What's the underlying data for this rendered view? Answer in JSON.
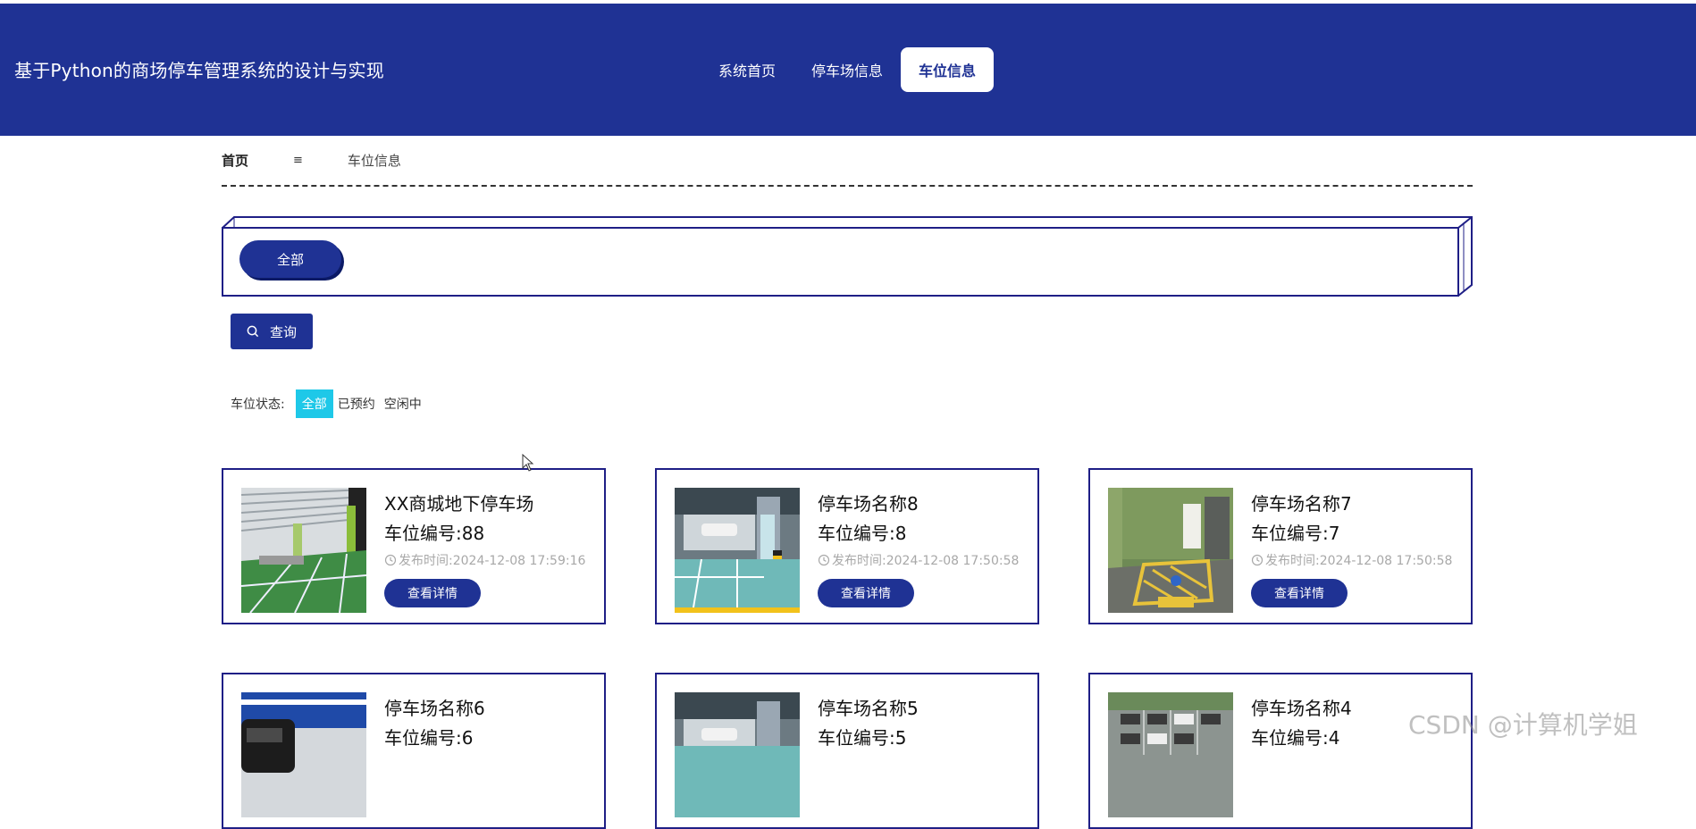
{
  "header": {
    "site_title": "基于Python的商场停车管理系统的设计与实现",
    "nav": [
      {
        "label": "系统首页",
        "active": false
      },
      {
        "label": "停车场信息",
        "active": false
      },
      {
        "label": "车位信息",
        "active": true
      }
    ]
  },
  "breadcrumb": {
    "home": "首页",
    "separator": "≡",
    "current": "车位信息"
  },
  "filter": {
    "category_all": "全部"
  },
  "query_button": "查询",
  "status": {
    "label": "车位状态:",
    "options": [
      {
        "label": "全部",
        "active": true
      },
      {
        "label": "已预约",
        "active": false
      },
      {
        "label": "空闲中",
        "active": false
      }
    ]
  },
  "cards": [
    {
      "name": "XX商城地下停车场",
      "number": "车位编号:88",
      "time": "发布时间:2024-12-08 17:59:16",
      "button": "查看详情",
      "image": "garage-green-floor"
    },
    {
      "name": "停车场名称8",
      "number": "车位编号:8",
      "time": "发布时间:2024-12-08 17:50:58",
      "button": "查看详情",
      "image": "garage-blue-lift"
    },
    {
      "name": "停车场名称7",
      "number": "车位编号:7",
      "time": "发布时间:2024-12-08 17:50:58",
      "button": "查看详情",
      "image": "garage-accessible-space"
    },
    {
      "name": "停车场名称6",
      "number": "车位编号:6",
      "time": "",
      "button": "",
      "image": "garage-car-blue-wall"
    },
    {
      "name": "停车场名称5",
      "number": "车位编号:5",
      "time": "",
      "button": "",
      "image": "garage-blue-lift"
    },
    {
      "name": "停车场名称4",
      "number": "车位编号:4",
      "time": "",
      "button": "",
      "image": "outdoor-lot-aerial"
    }
  ],
  "watermark": "CSDN @计算机学姐",
  "colors": {
    "primary": "#1f3294",
    "accent": "#1ec8e8",
    "card_border": "#1f1f86"
  }
}
